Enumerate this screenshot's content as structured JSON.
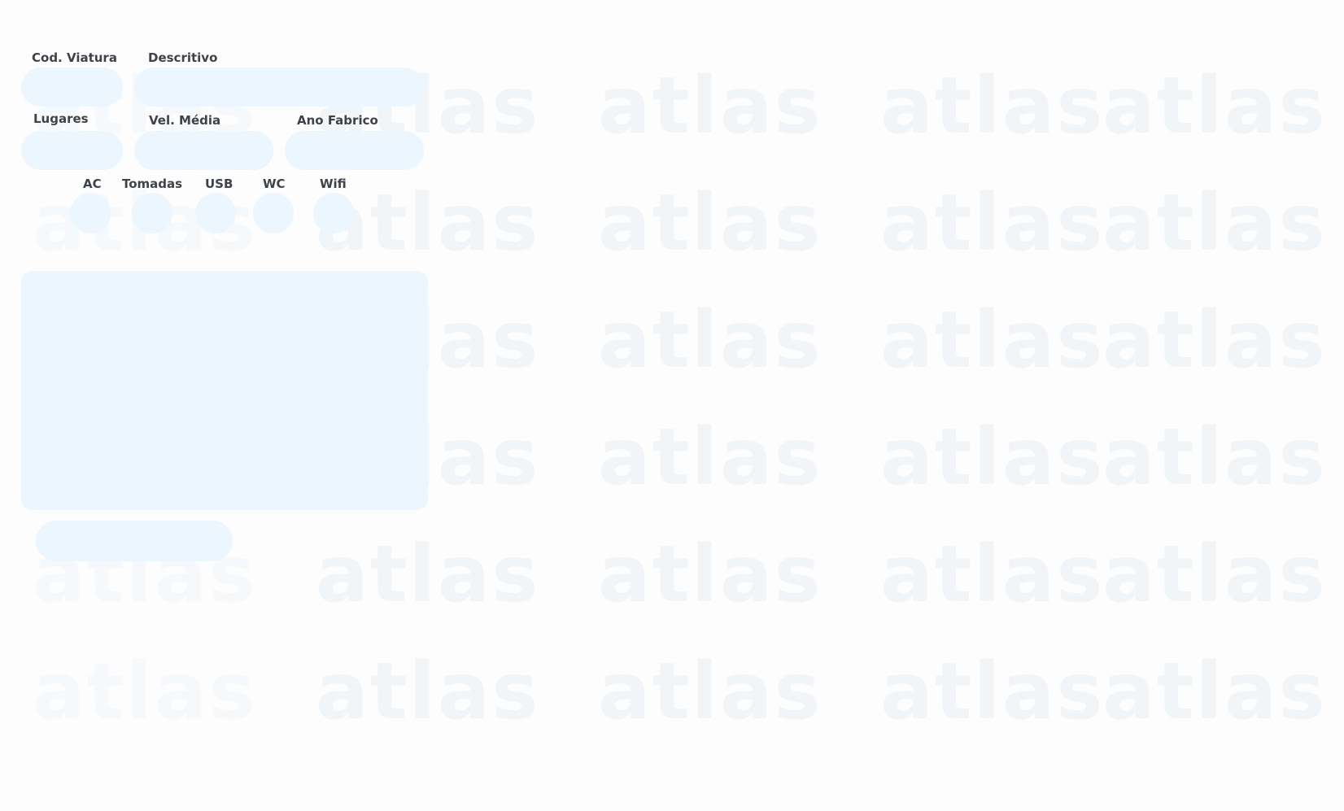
{
  "watermark": {
    "text": "atlas"
  },
  "form": {
    "cod_viatura": {
      "label": "Cod. Viatura",
      "value": ""
    },
    "descritivo": {
      "label": "Descritivo",
      "value": ""
    },
    "lugares": {
      "label": "Lugares",
      "value": ""
    },
    "vel_media": {
      "label": "Vel. Média",
      "value": ""
    },
    "ano_fabrico": {
      "label": "Ano Fabrico",
      "value": ""
    }
  },
  "features": {
    "ac": {
      "label": "AC",
      "checked": false
    },
    "tomadas": {
      "label": "Tomadas",
      "checked": false
    },
    "usb": {
      "label": "USB",
      "checked": false
    },
    "wc": {
      "label": "WC",
      "checked": false
    },
    "wifi": {
      "label": "Wifi",
      "checked": false
    }
  },
  "notes": {
    "value": ""
  },
  "submit": {
    "label": ""
  },
  "colors": {
    "field_background": "#ebf6ff",
    "label_text": "#3f4248",
    "watermark": "#f1f5f8",
    "page_background": "#fdfdfe"
  }
}
